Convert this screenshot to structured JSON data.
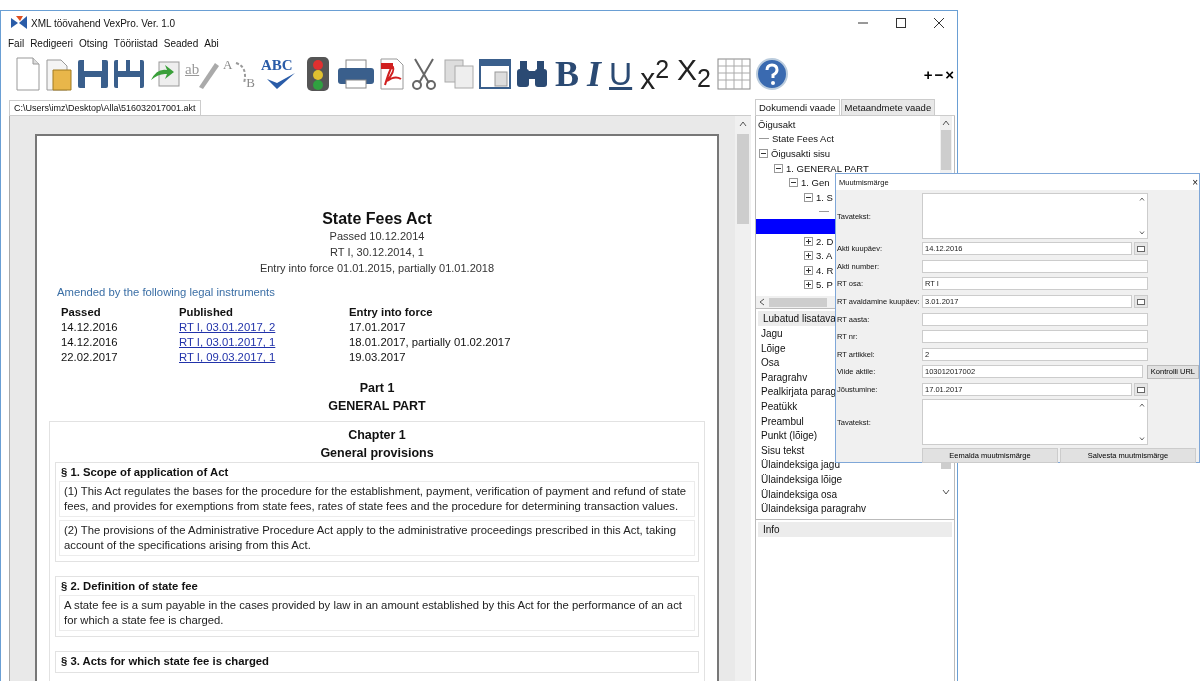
{
  "window": {
    "title": "XML töövahend VexPro. Ver. 1.0"
  },
  "menu": [
    "Fail",
    "Redigeeri",
    "Otsing",
    "Tööriistad",
    "Seaded",
    "Abi"
  ],
  "toolbar": [
    {
      "kind": "new"
    },
    {
      "kind": "open"
    },
    {
      "kind": "save"
    },
    {
      "kind": "saveall"
    },
    {
      "kind": "import"
    },
    {
      "kind": "rename",
      "label": "ab"
    },
    {
      "kind": "replace",
      "labels": [
        "A",
        "B"
      ]
    },
    {
      "kind": "spell",
      "label": "ABC"
    },
    {
      "kind": "validate"
    },
    {
      "kind": "print"
    },
    {
      "kind": "pdf"
    },
    {
      "kind": "cut"
    },
    {
      "kind": "copy"
    },
    {
      "kind": "paste"
    },
    {
      "kind": "find"
    },
    {
      "kind": "bold",
      "label": "B"
    },
    {
      "kind": "italic",
      "label": "I"
    },
    {
      "kind": "underline",
      "label": "U"
    },
    {
      "kind": "super",
      "label": "x$^{2}$"
    },
    {
      "kind": "sub",
      "label": "X$_{2}$"
    },
    {
      "kind": "table"
    },
    {
      "kind": "help"
    }
  ],
  "toolbar_end": [
    "+",
    "−",
    "×"
  ],
  "file_tab": {
    "label": "C:\\Users\\imz\\Desktop\\Alla\\516032017001.akt",
    "selected": true
  },
  "document": {
    "title": "State Fees Act",
    "meta": [
      "Passed 10.12.2014",
      "RT I, 30.12.2014, 1",
      "Entry into force 01.01.2015, partially 01.01.2018"
    ],
    "amended_heading": "Amended by the following legal instruments",
    "amendments": {
      "columns": [
        "Passed",
        "Published",
        "Entry into force"
      ],
      "rows": [
        [
          "14.12.2016",
          "RT I, 03.01.2017, 2",
          "17.01.2017"
        ],
        [
          "14.12.2016",
          "RT I, 03.01.2017, 1",
          "18.01.2017, partially 01.02.2017"
        ],
        [
          "22.02.2017",
          "RT I, 09.03.2017, 1",
          "19.03.2017"
        ]
      ]
    },
    "part": [
      "Part 1",
      "GENERAL PART"
    ],
    "chapter": [
      "Chapter 1",
      "General provisions"
    ],
    "sections": [
      {
        "heading": "§ 1. Scope of application of Act",
        "paragraphs": [
          "(1) This Act regulates the bases for the procedure for the establishment, payment, verification of payment and refund of state fees, and provides for exemptions from state fees, rates of state fees and the procedure for determining transaction values.",
          "(2) The provisions of the Administrative Procedure Act apply to the administrative proceedings prescribed in this Act, taking account of the specifications arising from this Act."
        ]
      },
      {
        "heading": "§ 2. Definition of state fee",
        "paragraphs": [
          "A state fee is a sum payable in the cases provided by law in an amount established by this Act for the performance of an act for which a state fee is charged."
        ]
      },
      {
        "heading": "§ 3. Acts for which state fee is charged"
      }
    ]
  },
  "side_tabs": [
    {
      "label": "Dokumendi vaade",
      "selected": true
    },
    {
      "label": "Metaandmete vaade",
      "selected": false
    }
  ],
  "tree": [
    {
      "label": "Õigusakt",
      "selected": false,
      "children": [
        {
          "label": "State Fees Act",
          "selected": false
        },
        {
          "label": "Õigusakti sisu",
          "selected": false,
          "expanded": true,
          "children": [
            {
              "label": "1. GENERAL PART",
              "selected": false,
              "expanded": true,
              "children": [
                {
                  "label": "1. Gen",
                  "selected": false,
                  "expanded": true,
                  "children": [
                    {
                      "label": "1. S",
                      "selected": false,
                      "expanded": true,
                      "children": [
                        {
                          "selected": false
                        },
                        {
                          "selected": true
                        }
                      ]
                    },
                    {
                      "label": "2. D",
                      "selected": false,
                      "expanded": false
                    },
                    {
                      "label": "3. A",
                      "selected": false,
                      "expanded": false
                    },
                    {
                      "label": "4. R",
                      "selected": false,
                      "expanded": false
                    },
                    {
                      "label": "5. P",
                      "selected": false,
                      "expanded": false
                    }
                  ]
                }
              ]
            }
          ]
        }
      ]
    }
  ],
  "allowed": {
    "title": "Lubatud lisatava",
    "items": [
      "Jagu",
      "Lõige",
      "Osa",
      "Paragrahv",
      "Pealkirjata parag",
      "Peatükk",
      "Preambul",
      "Punkt (lõige)",
      "Sisu tekst",
      "Ülaindeksiga jagu",
      "Ülaindeksiga lõige",
      "Ülaindeksiga osa",
      "Ülaindeksiga paragrahv"
    ]
  },
  "info": {
    "title": "Info"
  },
  "dialog": {
    "title": "Muutmismärge",
    "close": "×",
    "fields": [
      {
        "kind": "textarea",
        "label": "Tavatekst:"
      },
      {
        "kind": "date",
        "label": "Akti kuupäev:",
        "value": "14.12.2016"
      },
      {
        "kind": "text",
        "label": "Akti number:"
      },
      {
        "kind": "text",
        "label": "RT osa:",
        "value": "RT I"
      },
      {
        "kind": "date",
        "label": "RT avaldamine kuupäev:",
        "value": "3.01.2017"
      },
      {
        "kind": "text",
        "label": "RT aasta:"
      },
      {
        "kind": "text",
        "label": "RT nr:"
      },
      {
        "kind": "text",
        "label": "RT artikkel:",
        "value": "2"
      },
      {
        "kind": "url",
        "label": "Viide aktile:",
        "value": "103012017002",
        "button": "Kontrolli URL"
      },
      {
        "kind": "date",
        "label": "Jõustumine:",
        "value": "17.01.2017"
      },
      {
        "kind": "textarea",
        "label": "Tavatekst:"
      }
    ],
    "buttons": [
      "Eemalda muutmismärge",
      "Salvesta muutmismärge"
    ]
  }
}
